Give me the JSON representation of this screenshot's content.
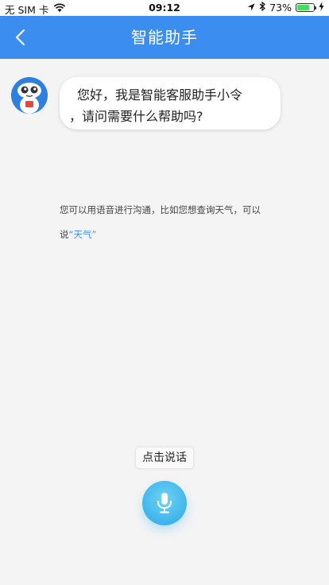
{
  "status_bar": {
    "carrier": "无 SIM 卡",
    "time": "09:12",
    "battery_percent": "73%",
    "battery_level": 0.73,
    "icons": [
      "wifi-icon",
      "location-icon",
      "bluetooth-icon",
      "battery-icon",
      "charging-icon"
    ]
  },
  "nav": {
    "title": "智能助手",
    "back_icon": "chevron-left-icon"
  },
  "chat": {
    "greeting_line1": "您好，我是智能客服助手小令",
    "greeting_line2": "，请问需要什么帮助吗?"
  },
  "hint": {
    "line1": "您可以用语音进行沟通，比如您想查询天气，可以",
    "line2_prefix": "说",
    "keyword": "“天气”"
  },
  "voice": {
    "label": "点击说话",
    "icon": "microphone-icon"
  },
  "colors": {
    "primary": "#3b8ef0",
    "mic_button": "#3fb4ec",
    "background": "#f4f4f4"
  }
}
